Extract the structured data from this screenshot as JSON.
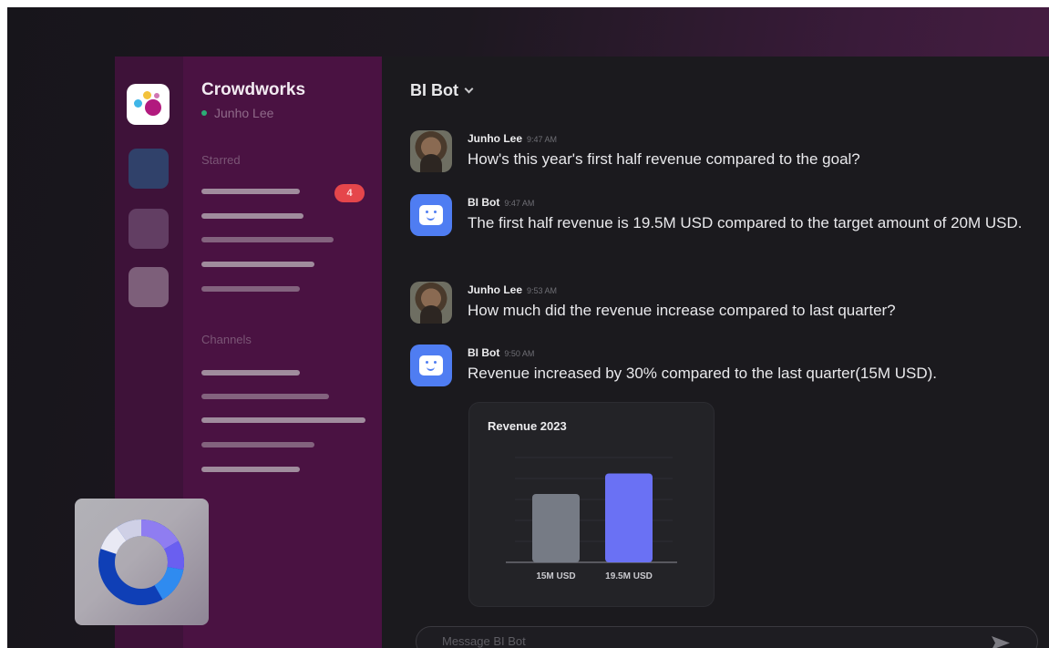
{
  "workspace": {
    "name": "Crowdworks",
    "current_user": "Junho Lee",
    "starred_label": "Starred",
    "starred_badge": "4",
    "channels_label": "Channels"
  },
  "channel": {
    "title": "BI Bot"
  },
  "messages": [
    {
      "author": "Junho Lee",
      "time": "9:47 AM",
      "text": "How's this year's first half revenue compared to the goal?",
      "avatar": "person"
    },
    {
      "author": "BI Bot",
      "time": "9:47 AM",
      "text": "The first half revenue is 19.5M USD compared to the target amount of 20M USD.",
      "avatar": "bot"
    },
    {
      "author": "Junho Lee",
      "time": "9:53 AM",
      "text": "How much did the revenue increase compared to last quarter?",
      "avatar": "person"
    },
    {
      "author": "BI Bot",
      "time": "9:50 AM",
      "text": "Revenue increased by 30% compared to the last quarter(15M USD).",
      "avatar": "bot"
    }
  ],
  "chart_data": {
    "type": "bar",
    "title": "Revenue 2023",
    "categories": [
      "15M USD",
      "19.5M USD"
    ],
    "values": [
      15,
      19.5
    ],
    "ylim": [
      0,
      23
    ],
    "grid": true,
    "colors": [
      "#767b85",
      "#6a71f4"
    ]
  },
  "composer": {
    "placeholder": "Message BI Bot"
  },
  "icons": {
    "workspace_logo": "workspace-logo-icon",
    "send": "send-icon",
    "chevron": "chevron-down-icon",
    "overlay": "donut-chart-icon"
  },
  "colors": {
    "sidebar": "#4a1242",
    "rail": "#3e1239",
    "main": "#1b1a1e",
    "accent": "#4f7df2",
    "badge": "#e5464b"
  }
}
